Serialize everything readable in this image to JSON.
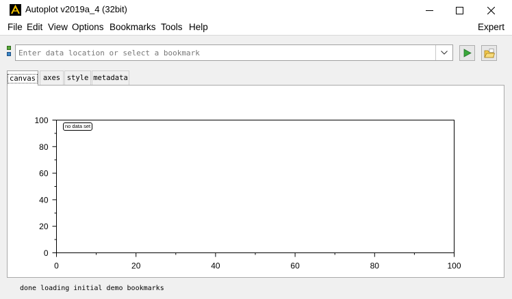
{
  "window": {
    "title": "Autoplot v2019a_4 (32bit)",
    "controls": [
      "minimize-icon",
      "maximize-icon",
      "close-icon"
    ]
  },
  "menubar": {
    "items": [
      "File",
      "Edit",
      "View",
      "Options",
      "Bookmarks",
      "Tools",
      "Help"
    ],
    "right_label": "Expert"
  },
  "datasource": {
    "placeholder": "Enter data location or select a bookmark",
    "value": ""
  },
  "toolbar": {
    "icons": [
      "datasource-stack-icon",
      "chevron-down-icon",
      "play-icon",
      "open-folder-icon"
    ],
    "play_color": "#3aa83a"
  },
  "tabs": [
    "canvas",
    "axes",
    "style",
    "metadata"
  ],
  "active_tab": "canvas",
  "plot": {
    "message": "no data set"
  },
  "chart_data": {
    "type": "line",
    "series": [],
    "x_ticks": [
      "0",
      "20",
      "40",
      "60",
      "80",
      "100"
    ],
    "y_ticks": [
      "0",
      "20",
      "40",
      "60",
      "80",
      "100"
    ],
    "xlim": [
      0,
      100
    ],
    "ylim": [
      0,
      100
    ],
    "x_minor_step": 10,
    "y_minor_step": 10,
    "title": "",
    "xlabel": "",
    "ylabel": "",
    "grid": false
  },
  "status": {
    "text": "done loading initial demo bookmarks"
  }
}
